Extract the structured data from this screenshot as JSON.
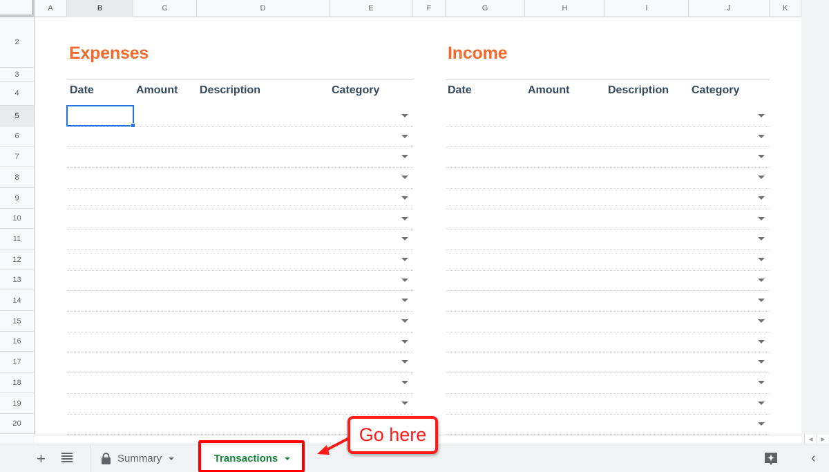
{
  "columns": [
    "A",
    "B",
    "C",
    "D",
    "E",
    "F",
    "G",
    "H",
    "I",
    "J",
    "K"
  ],
  "selected_column": "B",
  "rows": [
    "2",
    "3",
    "4",
    "5",
    "6",
    "7",
    "8",
    "9",
    "10",
    "11",
    "12",
    "13",
    "14",
    "15",
    "16",
    "17",
    "18",
    "19",
    "20"
  ],
  "selected_row": "5",
  "expenses": {
    "title": "Expenses",
    "headers": [
      "Date",
      "Amount",
      "Description",
      "Category"
    ]
  },
  "income": {
    "title": "Income",
    "headers": [
      "Date",
      "Amount",
      "Description",
      "Category"
    ]
  },
  "colors": {
    "title_accent": "#f26a2e",
    "header_text": "#34495e",
    "selection": "#1a73e8",
    "active_tab": "#188038",
    "annotation": "#ff0000"
  },
  "tabbar": {
    "add_sheet_icon": "plus-icon",
    "all_sheets_icon": "list-icon",
    "tabs": [
      {
        "label": "Summary",
        "locked": true,
        "active": false
      },
      {
        "label": "Transactions",
        "locked": false,
        "active": true
      }
    ],
    "explore_icon": "explore-sparkle-icon",
    "collapse_icon": "chevron-left-icon"
  },
  "annotation": {
    "callout_text": "Go here"
  }
}
